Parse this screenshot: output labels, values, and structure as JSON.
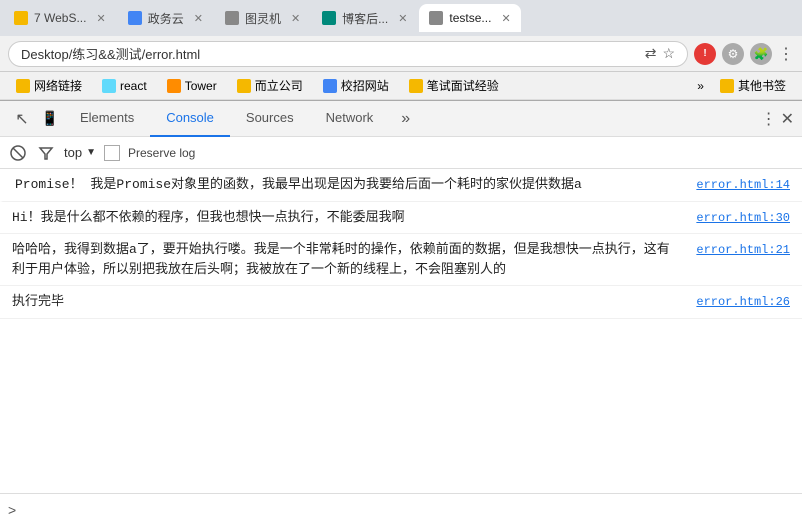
{
  "browser": {
    "tabs": [
      {
        "id": 1,
        "label": "7 WebS...",
        "active": false,
        "favicon_color": "#f5b800"
      },
      {
        "id": 2,
        "label": "政务云",
        "active": false,
        "favicon_color": "#4285f4"
      },
      {
        "id": 3,
        "label": "图灵机",
        "active": false,
        "favicon_color": "#888"
      },
      {
        "id": 4,
        "label": "博客后...",
        "active": false,
        "favicon_color": "#00897b"
      },
      {
        "id": 5,
        "label": "testse...",
        "active": true,
        "favicon_color": "#888"
      }
    ],
    "address": "Desktop/练习&&测试/error.html",
    "bookmarks": [
      {
        "label": "网络链接",
        "color": "#f5b800"
      },
      {
        "label": "react",
        "color": "#61dafb"
      },
      {
        "label": "Tower",
        "color": "#f5b800"
      },
      {
        "label": "而立公司",
        "color": "#f5b800"
      },
      {
        "label": "校招网站",
        "color": "#4285f4"
      },
      {
        "label": "笔试面试经验",
        "color": "#f5b800"
      }
    ],
    "bookmarks_more": "»",
    "bookmarks_right": "其他书签"
  },
  "devtools": {
    "tabs": [
      {
        "label": "Elements"
      },
      {
        "label": "Console",
        "active": true
      },
      {
        "label": "Sources"
      },
      {
        "label": "Network"
      }
    ],
    "more_label": "»",
    "console": {
      "top_filter": "top",
      "preserve_log": "Preserve log",
      "messages": [
        {
          "id": 1,
          "text": "Promise！我是Promise对象里的函数，我最早出现是因为我要给后面一个耗时的家伙提供数据a",
          "link": "error.html:14"
        },
        {
          "id": 2,
          "text": "Hi！我是什么都不依赖的程序，但我也想快一点执行，不能委屈我啊",
          "link": "error.html:30"
        },
        {
          "id": 3,
          "text": "哈哈哈，我得到数据a了，要开始执行喽。我是一个非常耗时的操作，依赖前面的数据，但是我想快一点执行，这有利于用户体验，所以别把我放在后头啊；我被放在了一个新的线程上，不会阻塞别人的",
          "link": "error.html:21"
        },
        {
          "id": 4,
          "text": "执行完毕",
          "link": "error.html:26"
        }
      ],
      "input_prompt": ">"
    }
  }
}
